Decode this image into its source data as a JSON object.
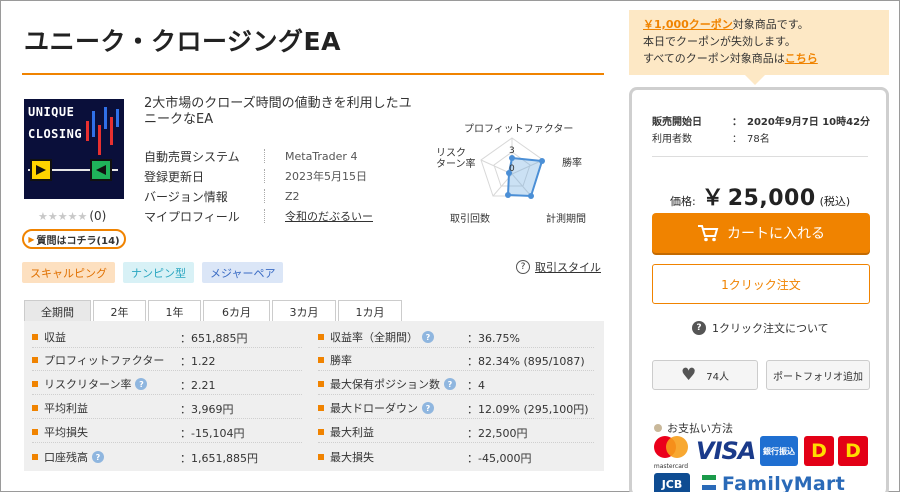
{
  "product": {
    "title": "ユニーク・クロージングEA",
    "description": "2大市場のクローズ時間の値動きを利用したユニークなEA",
    "image_text_line1": "UNIQUE",
    "image_text_line2": "CLOSING",
    "rating_stars": "★★★★★",
    "rating_count": "(0)",
    "qa_label": "質問はコチラ(14)",
    "info": [
      {
        "label": "自動売買システム",
        "value": "MetaTrader 4"
      },
      {
        "label": "登録更新日",
        "value": "2023年5月15日"
      },
      {
        "label": "バージョン情報",
        "value": "Z2"
      },
      {
        "label": "マイプロフィール",
        "value": "令和のだぶるいー"
      }
    ]
  },
  "radar": {
    "labels": {
      "top": "プロフィットファクター",
      "right": "勝率",
      "bottom_right": "計測期間",
      "bottom_left": "取引回数",
      "left": "リスク\nターン率"
    },
    "scale_3": "3",
    "scale_0": "0",
    "colors": {
      "fill": "#6aa8e0",
      "grid": "#d8d8d8"
    }
  },
  "trade_style_link": "取引スタイル",
  "tags": [
    {
      "label": "スキャルピング",
      "bg": "#fde0c0",
      "fg": "#e07000"
    },
    {
      "label": "ナンピン型",
      "bg": "#d8f1f6",
      "fg": "#2aa6c0"
    },
    {
      "label": "メジャーペア",
      "bg": "#dbe6f7",
      "fg": "#3b6cc4"
    }
  ],
  "tabs": [
    "全期間",
    "2年",
    "1年",
    "6カ月",
    "3カ月",
    "1カ月"
  ],
  "stats_left": [
    {
      "label": "収益",
      "value": "：651,885円",
      "help": false
    },
    {
      "label": "プロフィットファクター",
      "value": "：1.22",
      "help": false
    },
    {
      "label": "リスクリターン率",
      "value": "：2.21",
      "help": true
    },
    {
      "label": "平均利益",
      "value": "：3,969円",
      "help": false
    },
    {
      "label": "平均損失",
      "value": "：-15,104円",
      "help": false
    },
    {
      "label": "口座残高",
      "value": "：1,651,885円",
      "help": true
    }
  ],
  "stats_right": [
    {
      "label": "収益率（全期間）",
      "value": "：36.75%",
      "help": true
    },
    {
      "label": "勝率",
      "value": "：82.34% (895/1087)",
      "help": false
    },
    {
      "label": "最大保有ポジション数",
      "value": "：4",
      "help": true
    },
    {
      "label": "最大ドローダウン",
      "value": "：12.09% (295,100円)",
      "help": true
    },
    {
      "label": "最大利益",
      "value": "：22,500円",
      "help": false
    },
    {
      "label": "最大損失",
      "value": "：-45,000円",
      "help": false
    }
  ],
  "coupon": {
    "coupon_link": "￥1,000クーポン",
    "line1_rest": "対象商品です。",
    "line2": "本日でクーポンが失効します。",
    "line3_prefix": "すべてのクーポン対象商品は",
    "line3_link": "こちら"
  },
  "purchase": {
    "sale_start_label": "販売開始日",
    "sale_start_value": "：　2020年9月7日 10時42分",
    "users_label": "利用者数",
    "users_value": "：　78名",
    "price_label": "価格:",
    "price_yen": "￥",
    "price_amount": "25,000",
    "price_tax": "(税込)",
    "cart_label": "カートに入れる",
    "oneclick_label": "1クリック注文",
    "oneclick_help": "1クリック注文について",
    "fav_count": "74人",
    "portfolio_label": "ポートフォリオ追加",
    "payment_title": "お支払い方法",
    "mastercard_text": "mastercard",
    "visa_text": "VISA",
    "bank_text": "銀行振込",
    "d_text": "D",
    "jcb_text": "JCB",
    "familymart_text": "FamilyMart"
  },
  "colors": {
    "accent": "#f08300",
    "coupon_bg": "#fde8c5",
    "stats_bg": "#efefef"
  }
}
